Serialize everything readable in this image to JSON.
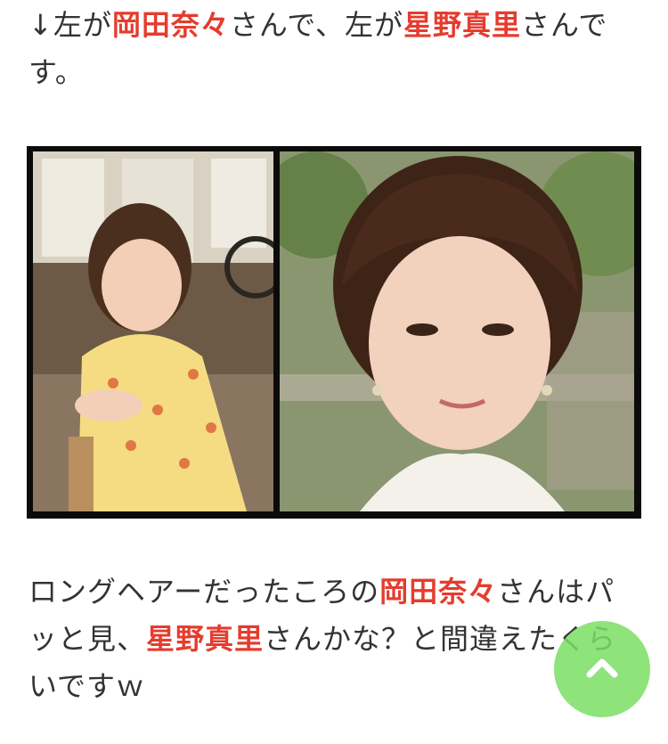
{
  "intro": {
    "arrow": "↓",
    "t1": "左が",
    "name1": "岡田奈々",
    "t2": "さんで、左が",
    "name2": "星野真里",
    "t3": "さんです。"
  },
  "photos": {
    "left_subject": "岡田奈々",
    "right_subject": "星野真里"
  },
  "body": {
    "t1": "ロングヘアーだったころの",
    "name1": "岡田奈々",
    "t2": "さんはパッと見、",
    "name2": "星野真里",
    "t3": "さんかな？と間違えたくらいですｗ"
  },
  "scroll_top": {
    "icon": "chevron-up-icon"
  },
  "colors": {
    "highlight": "#e53c2e",
    "text": "#333333",
    "scroll_button": "#7ade64"
  }
}
